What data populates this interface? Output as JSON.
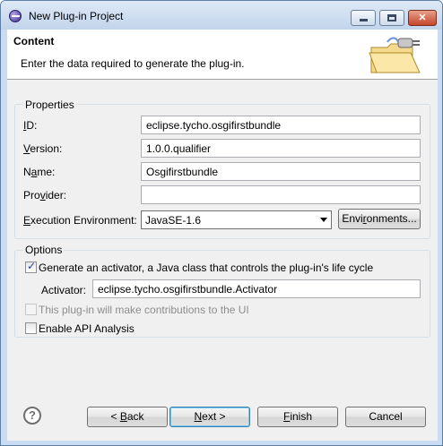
{
  "window": {
    "title": "New Plug-in Project"
  },
  "header": {
    "title": "Content",
    "description": "Enter the data required to generate the plug-in."
  },
  "properties": {
    "group_label": "Properties",
    "id_label": "ID:",
    "id_value": "eclipse.tycho.osgifirstbundle",
    "version_label": "Version:",
    "version_value": "1.0.0.qualifier",
    "name_label": "Name:",
    "name_value": "Osgifirstbundle",
    "provider_label": "Provider:",
    "provider_value": "",
    "exec_env_label": "Execution Environment:",
    "exec_env_value": "JavaSE-1.6",
    "environments_button": "Environments..."
  },
  "options": {
    "group_label": "Options",
    "generate_activator_label": "Generate an activator, a Java class that controls the plug-in's life cycle",
    "generate_activator_checked": true,
    "activator_label": "Activator:",
    "activator_value": "eclipse.tycho.osgifirstbundle.Activator",
    "ui_contrib_label": "This plug-in will make contributions to the UI",
    "ui_contrib_checked": false,
    "api_analysis_label": "Enable API Analysis",
    "api_analysis_checked": false
  },
  "footer": {
    "help_symbol": "?",
    "back_button": "< Back",
    "next_button": "Next >",
    "finish_button": "Finish",
    "cancel_button": "Cancel"
  },
  "colors": {
    "title_bar": "#c9dcf2",
    "dialog_bg": "#f0f0f0",
    "default_button_border": "#3c7fb1"
  }
}
